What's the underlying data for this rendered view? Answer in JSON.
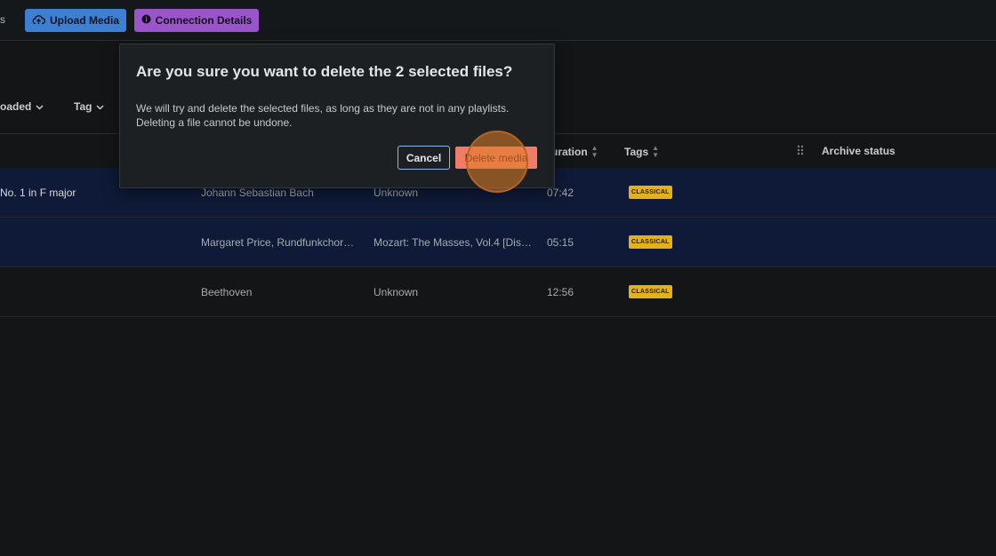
{
  "topbar": {
    "left_edge_text": "s",
    "upload_label": "Upload Media",
    "connection_label": "Connection Details"
  },
  "filters": [
    {
      "label": "oaded"
    },
    {
      "label": "Tag"
    }
  ],
  "table": {
    "headers": {
      "duration": "uration",
      "tags": "Tags",
      "archive": "Archive status"
    },
    "rows": [
      {
        "title": "No. 1 in F major",
        "artist": "Johann Sebastian Bach",
        "album": "Unknown",
        "duration": "07:42",
        "tag": "CLASSICAL",
        "selected": true
      },
      {
        "title": "",
        "artist": "Margaret Price, Rundfunkchor…",
        "album": "Mozart: The Masses, Vol.4 [Dis…",
        "duration": "05:15",
        "tag": "CLASSICAL",
        "selected": true
      },
      {
        "title": "",
        "artist": "Beethoven",
        "album": "Unknown",
        "duration": "12:56",
        "tag": "CLASSICAL",
        "selected": false
      }
    ]
  },
  "dialog": {
    "title": "Are you sure you want to delete the 2 selected files?",
    "body_line1": "We will try and delete the selected files, as long as they are not in any playlists.",
    "body_line2": "Deleting a file cannot be undone.",
    "cancel_label": "Cancel",
    "delete_label": "Delete media"
  },
  "colors": {
    "upload_button": "#3f7fd3",
    "connection_button": "#9a55c9",
    "delete_button": "#f07b67",
    "selected_row": "#0e1a37",
    "tag_badge": "#e3b21b"
  },
  "icons": {
    "upload": "cloud-upload-icon",
    "connection": "info-icon",
    "chevron": "chevron-down-icon",
    "sort": "sort-icon",
    "drag": "drag-handle-icon"
  }
}
